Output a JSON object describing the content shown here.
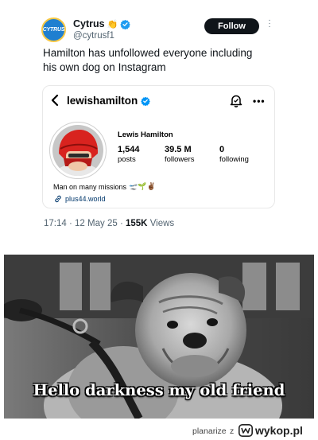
{
  "tweet": {
    "avatar_text": "CYTRUS",
    "display_name": "Cytrus",
    "name_emoji": "👏",
    "handle": "@cytrusf1",
    "follow_label": "Follow",
    "text": "Hamilton has unfollowed everyone including his own dog on Instagram",
    "time": "17:14",
    "separator": "·",
    "date": "12 May 25",
    "views_count": "155K",
    "views_label": "Views"
  },
  "instagram_profile": {
    "username": "lewishamilton",
    "full_name": "Lewis Hamilton",
    "stats": [
      {
        "value": "1,544",
        "label": "posts"
      },
      {
        "value": "39.5 M",
        "label": "followers"
      },
      {
        "value": "0",
        "label": "following"
      }
    ],
    "bio": "Man on many missions",
    "bio_emojis": "🛫🌱✌🏾",
    "link": "plus44.world"
  },
  "meme": {
    "caption": "Hello darkness my old friend"
  },
  "footer": {
    "user": "planarize",
    "connector": "z",
    "site": "wykop.pl"
  },
  "colors": {
    "verified_blue": "#1d9bf0",
    "ig_verified_blue": "#0095f6",
    "text_primary": "#0f1419",
    "text_secondary": "#536471",
    "follow_button": "#0f1419",
    "ig_link": "#00376b"
  },
  "icons": [
    "verified-badge-icon",
    "more-options-icon",
    "back-arrow-icon",
    "notification-bell-icon",
    "link-icon",
    "wykop-logo-icon"
  ]
}
